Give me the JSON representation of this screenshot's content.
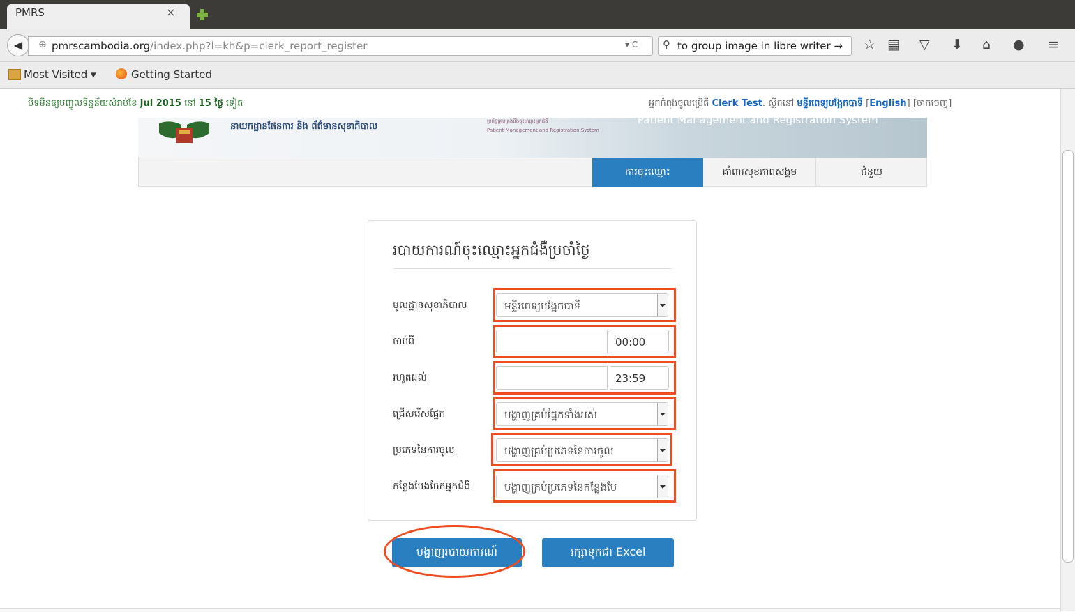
{
  "browser": {
    "tab_title": "PMRS",
    "tab_close": "×",
    "url_domain": "pmrscambodia.org",
    "url_path": "/index.php?l=kh&p=clerk_report_register",
    "url_dropdown": "▾ C",
    "search_text": "to group image in libre writer →",
    "bookmarks": [
      "Most Visited ▾",
      "Getting Started"
    ]
  },
  "notice": {
    "text_before": "បិទមិនឲ្យបញ្ចូលទិន្នន័យសំរាប់ខែ ",
    "month": "Jul 2015",
    "text_mid": " នៅ ",
    "days": "15 ថ្ងៃ",
    "text_after": " ទៀត"
  },
  "userbar": {
    "prefix": "អ្នកកំពុងចូលប្រើតី ",
    "user": "Clerk Test",
    "mid": ". ស្ថិតនៅ ",
    "facility": "មន្ទីរពេទ្យបង្អែកបាទី",
    "lang_link": "English",
    "logout": "ចាកចេញ"
  },
  "banner": {
    "org_name": "នាយកដ្ឋានផែនការ និង ព័ត៌មានសុខាភិបាល",
    "system_kh": "ប្រព័ន្ធគ្រប់គ្រងនិងចុះឈ្មោះអ្នកជំងឺ",
    "system_en": "Patient Management and Registration System",
    "system_big": "Patient Management and Registration System"
  },
  "menu": {
    "registration": "ការចុះឈ្មោះ",
    "public_health": "គាំពារសុខភាពសង្គម",
    "help": "ជំនួយ"
  },
  "form": {
    "title": "របាយការណ៍ចុះឈ្មោះអ្នកជំងឺប្រចាំថ្ងៃ",
    "health_facility_label": "មូលដ្ឋានសុខាភិបាល",
    "health_facility_value": "មន្ទីរពេទ្យបង្អែកបាទី",
    "from_label": "ចាប់ពី",
    "from_time": "00:00",
    "to_label": "រហូតដល់",
    "to_time": "23:59",
    "department_label": "ជ្រើសរើសផ្នែក",
    "department_value": "បង្ហាញគ្រប់ផ្នែកទាំងអស់",
    "admission_label": "ប្រភេទនៃការចូល",
    "admission_value": "បង្ហាញគ្រប់ប្រភេទនៃការចូល",
    "referral_label": "កន្លែងបែងចែកអ្នកជំងឺ",
    "referral_value": "បង្ហាញគ្រប់ប្រភេទនៃកន្លែងបែ"
  },
  "buttons": {
    "show_report": "បង្ហាញរបាយការណ៍",
    "save_excel": "រក្សាទុកជា Excel"
  },
  "colors": {
    "primary": "#2a7fc0",
    "highlight": "#ee4d1f",
    "notice": "#2e7d32"
  }
}
